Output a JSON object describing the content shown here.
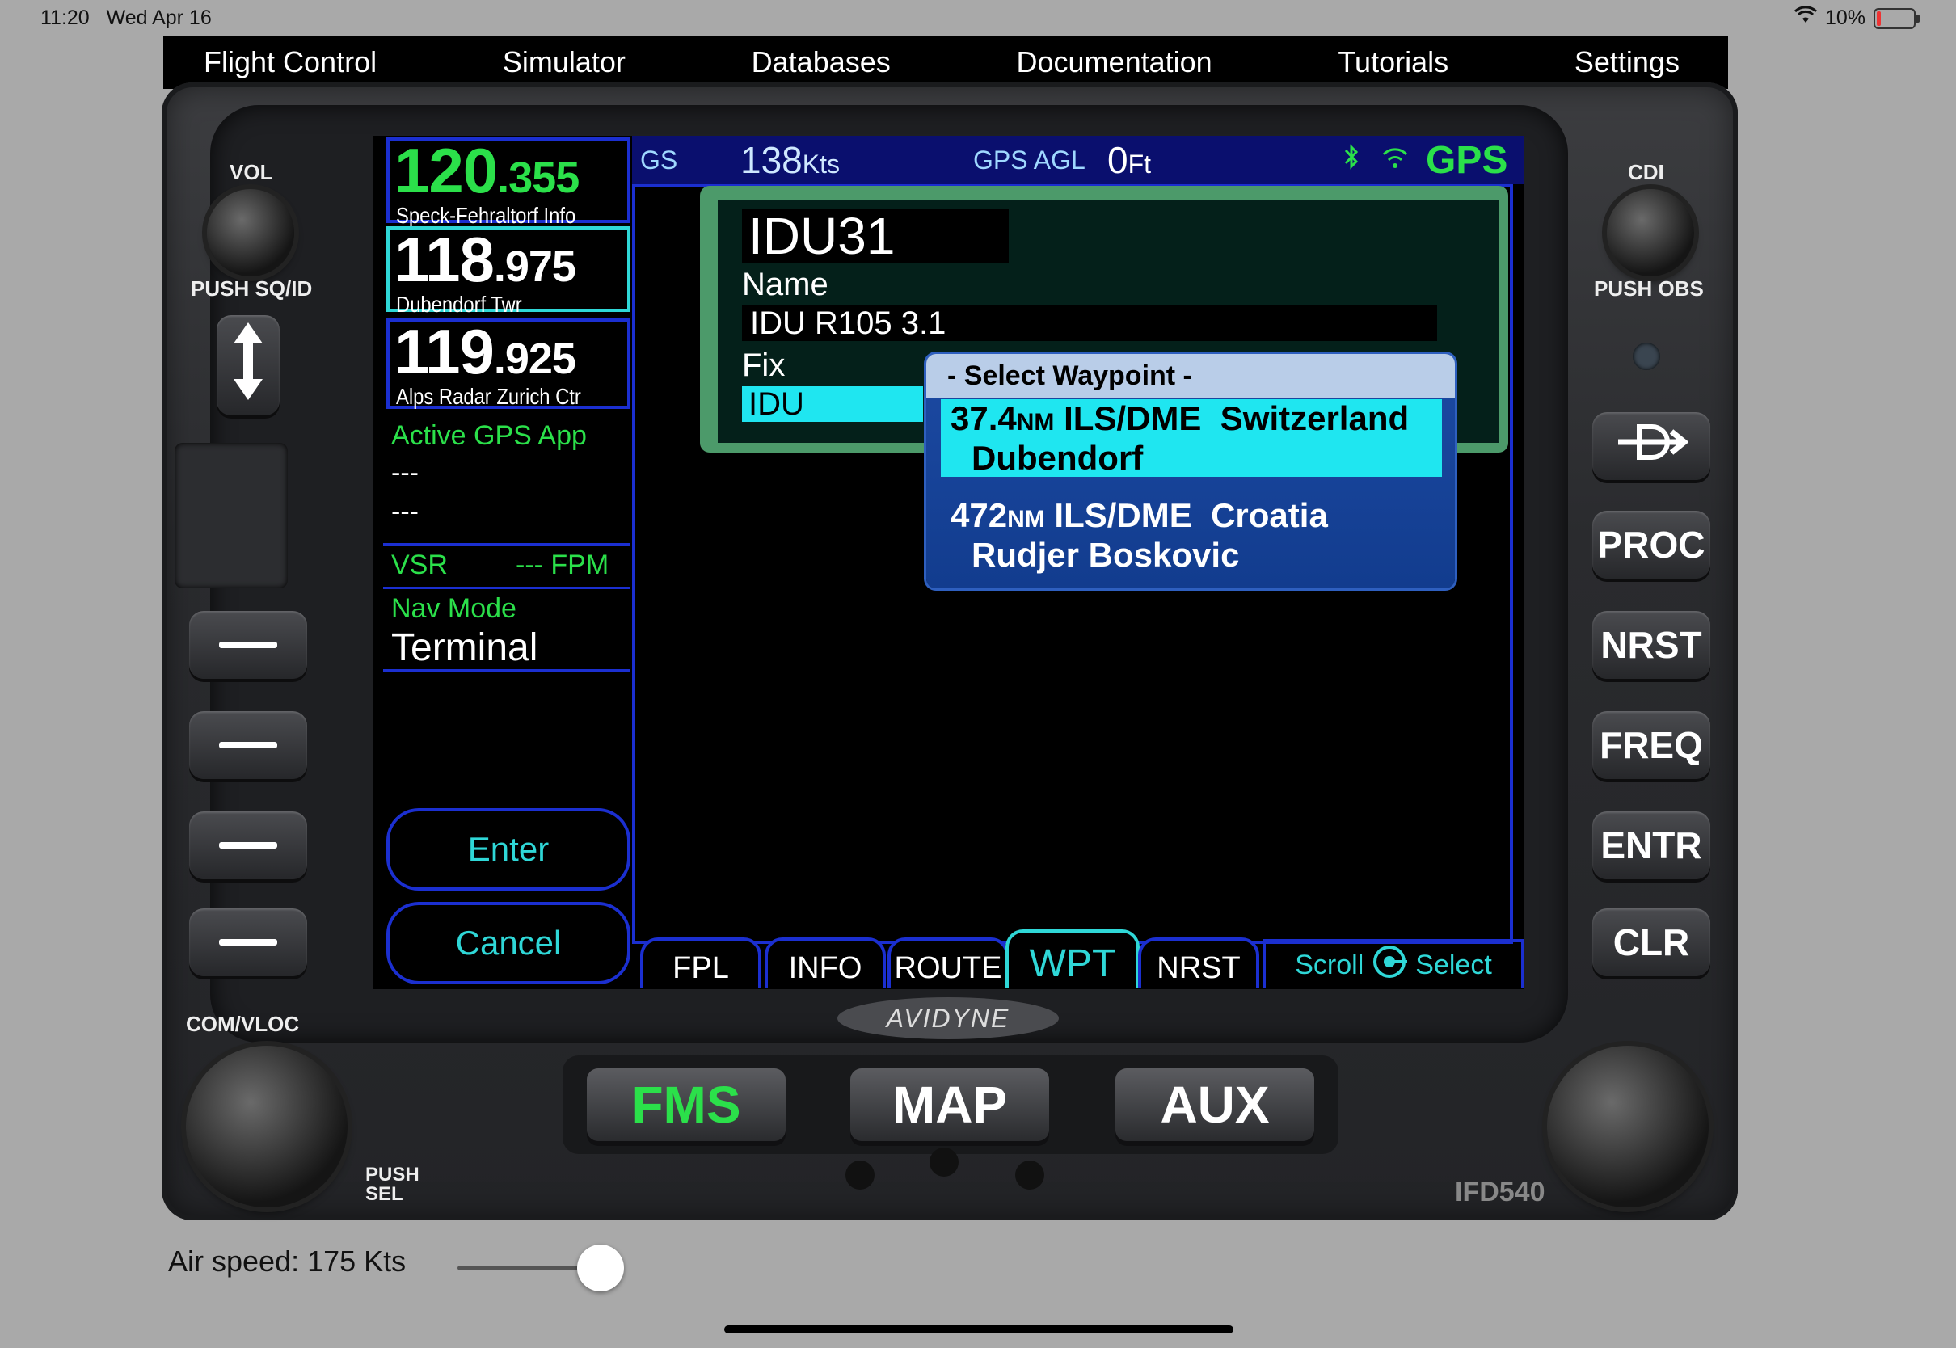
{
  "status_bar": {
    "time": "11:20",
    "date": "Wed Apr 16",
    "battery": "10%"
  },
  "menu": [
    "Flight Control",
    "Simulator",
    "Databases",
    "Documentation",
    "Tutorials",
    "Settings"
  ],
  "left_panel": {
    "freq1": {
      "main": "120",
      "decimal": ".355",
      "label": "Speck-Fehraltorf Info"
    },
    "freq2": {
      "main": "118",
      "decimal": ".975",
      "label": "Dubendorf Twr"
    },
    "freq3": {
      "main": "119",
      "decimal": ".925",
      "label": "Alps Radar Zurich Ctr"
    },
    "active_gps_app": "Active GPS App",
    "dash1": "---",
    "dash2": "---",
    "vsr_label": "VSR",
    "vsr_value": "--- FPM",
    "nav_mode_label": "Nav Mode",
    "nav_mode_value": "Terminal",
    "enter": "Enter",
    "cancel": "Cancel"
  },
  "top_strip": {
    "gs_label": "GS",
    "gs_value": "138",
    "gs_unit": "Kts",
    "agl_label": "GPS AGL",
    "agl_value": "0",
    "agl_unit": "Ft",
    "gps": "GPS"
  },
  "waypoint_card": {
    "ident": "IDU31",
    "name_label": "Name",
    "name_value": "IDU R105 3.1",
    "fix_label": "Fix",
    "fix_value": "IDU"
  },
  "popup": {
    "title": "- Select Waypoint -",
    "items": [
      {
        "dist": "37.4",
        "unit": "NM",
        "type": "ILS/DME",
        "country": "Switzerland",
        "name": "Dubendorf",
        "selected": true
      },
      {
        "dist": "472",
        "unit": "NM",
        "type": "ILS/DME",
        "country": "Croatia",
        "name": "Rudjer Boskovic",
        "selected": false
      }
    ]
  },
  "tabs": [
    "FPL",
    "INFO",
    "ROUTE",
    "WPT",
    "NRST"
  ],
  "scroll_select": {
    "scroll": "Scroll",
    "select": "Select"
  },
  "bezel": {
    "brand": "AVIDYNE",
    "model": "IFD540",
    "vol": "VOL",
    "push_sqid": "PUSH SQ/ID",
    "cdi": "CDI",
    "push_obs": "PUSH OBS",
    "com_vloc": "COM/VLOC",
    "push_sel": "PUSH SEL",
    "right_buttons": [
      "PROC",
      "NRST",
      "FREQ",
      "ENTR",
      "CLR"
    ],
    "mode_buttons": [
      "FMS",
      "MAP",
      "AUX"
    ]
  },
  "airspeed": {
    "label": "Air speed: 175 Kts",
    "fraction": 0.82
  },
  "colors": {
    "freq_active": "#2be04a",
    "accent_cyan": "#2fd7d7",
    "frame_blue": "#1b2fd0",
    "selection": "#1fe6f0"
  }
}
